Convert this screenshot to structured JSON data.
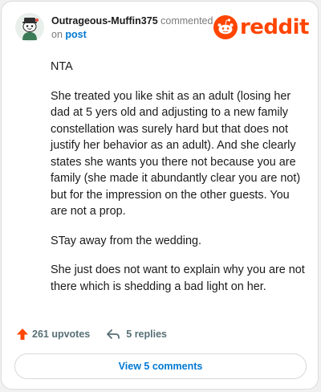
{
  "header": {
    "username": "Outrageous-Muffin375",
    "action_text": "commented",
    "on_text": "on",
    "post_link": "post",
    "logo_text": "reddit",
    "brand_color": "#ff4500",
    "link_color": "#0079d3",
    "avatar_icon": "snoo-avatar-icon"
  },
  "comment": {
    "paragraphs": [
      "NTA",
      "She treated you like shit as an adult (losing her dad at 5 yers old and adjusting to a new family constellation was surely hard but that does not justify her behavior as an adult). And she clearly states she wants you there not because you are family (she made it abundantly clear you are not) but for the impression on the other guests. You are not a prop.",
      "STay away from the wedding.",
      "She just does not want to explain why you are not there which is shedding a bad light on her."
    ]
  },
  "actions": {
    "upvotes": "261 upvotes",
    "replies": "5 replies",
    "upvote_icon": "upvote-arrow-icon",
    "reply_icon": "reply-arrow-icon"
  },
  "footer": {
    "view_comments": "View 5 comments"
  }
}
